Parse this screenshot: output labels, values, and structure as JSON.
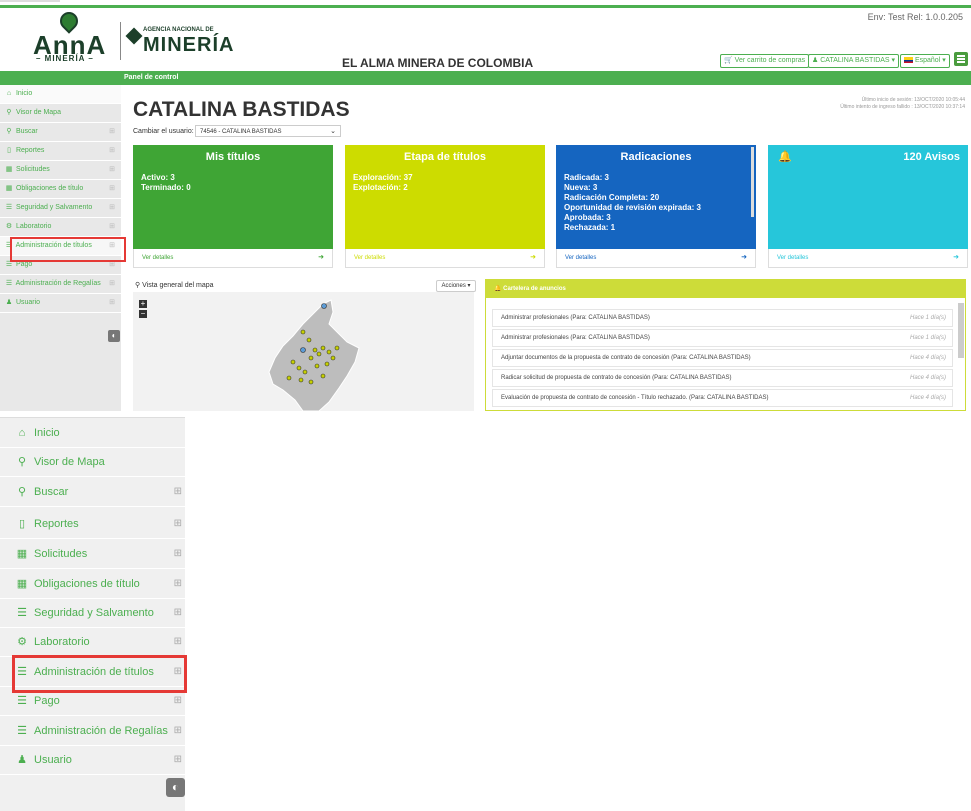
{
  "env": "Env: Test Rel: 1.0.0.205",
  "brand": {
    "anna": "AnnA",
    "anna_sub": "– MINERÍA –",
    "agencia": "AGENCIA NACIONAL DE",
    "mineria": "MINERÍA",
    "slogan": "EL ALMA MINERA DE COLOMBIA"
  },
  "header_buttons": {
    "cart": "Ver carrito de compras",
    "user": "CATALINA BASTIDAS ▾",
    "lang": "Español ▾"
  },
  "breadcrumb": "Panel de control",
  "sidebar": {
    "items": [
      {
        "label": "Inicio",
        "icon": "home-icon",
        "glyph": "⌂",
        "plus": ""
      },
      {
        "label": "Visor de Mapa",
        "icon": "map-marker-icon",
        "glyph": "⚲",
        "plus": ""
      },
      {
        "label": "Buscar",
        "icon": "search-icon",
        "glyph": "⚲",
        "plus": "⊞"
      },
      {
        "label": "Reportes",
        "icon": "file-icon",
        "glyph": "▯",
        "plus": "⊞"
      },
      {
        "label": "Solicitudes",
        "icon": "grid-icon",
        "glyph": "▦",
        "plus": "⊞"
      },
      {
        "label": "Obligaciones de título",
        "icon": "grid-icon",
        "glyph": "▦",
        "plus": "⊞"
      },
      {
        "label": "Seguridad y Salvamento",
        "icon": "list-icon",
        "glyph": "☰",
        "plus": "⊞"
      },
      {
        "label": "Laboratorio",
        "icon": "gear-icon",
        "glyph": "⚙",
        "plus": "⊞"
      },
      {
        "label": "Administración de títulos",
        "icon": "list-icon",
        "glyph": "☰",
        "plus": "⊞"
      },
      {
        "label": "Pago",
        "icon": "list-icon",
        "glyph": "☰",
        "plus": "⊞"
      },
      {
        "label": "Administración de Regalías",
        "icon": "list-icon",
        "glyph": "☰",
        "plus": "⊞"
      },
      {
        "label": "Usuario",
        "icon": "user-icon",
        "glyph": "♟",
        "plus": "⊞"
      }
    ]
  },
  "main": {
    "title": "CATALINA BASTIDAS",
    "last_login": "Último inicio de sesión: 13/OCT/2020 10:05:44",
    "last_failed": "Último intento de ingreso fallido : 13/OCT/2020 10:37:14",
    "change_user_label": "Cambiar el usuario:",
    "user_select_value": "74546 - CATALINA BASTIDAS"
  },
  "cards": [
    {
      "title": "Mis títulos",
      "lines": [
        "Activo: 3",
        "Terminado: 0"
      ],
      "footer": "Ver detalles",
      "color": "#3fa535"
    },
    {
      "title": "Etapa de títulos",
      "lines": [
        "Exploración: 37",
        "Explotación: 2"
      ],
      "footer": "Ver detalles",
      "color": "#cddc00"
    },
    {
      "title": "Radicaciones",
      "lines": [
        "Radicada: 3",
        "Nueva: 3",
        "Radicación Completa: 20",
        "Oportunidad de revisión expirada: 3",
        "Aprobada: 3",
        "Rechazada: 1"
      ],
      "footer": "Ver detalles",
      "color": "#1565c0"
    },
    {
      "title": "120 Avisos",
      "lines": [],
      "footer": "Ver detalles",
      "color": "#26c6da"
    }
  ],
  "map": {
    "title": "Vista general del mapa",
    "actions": "Acciones ▾"
  },
  "announcements": {
    "title": "Cartelera de anuncios",
    "items": [
      {
        "text": "Administrar profesionales (Para: CATALINA BASTIDAS)",
        "time": "Hace 1 día(s)"
      },
      {
        "text": "Administrar profesionales (Para: CATALINA BASTIDAS)",
        "time": "Hace 1 día(s)"
      },
      {
        "text": "Adjuntar documentos de la propuesta de contrato de concesión (Para: CATALINA BASTIDAS)",
        "time": "Hace 4 día(s)"
      },
      {
        "text": "Radicar solicitud de propuesta de contrato de concesión (Para: CATALINA BASTIDAS)",
        "time": "Hace 4 día(s)"
      },
      {
        "text": "Evaluación de propuesta de contrato de concesión - Título rechazado. (Para: CATALINA BASTIDAS)",
        "time": "Hace 4 día(s)"
      }
    ]
  }
}
